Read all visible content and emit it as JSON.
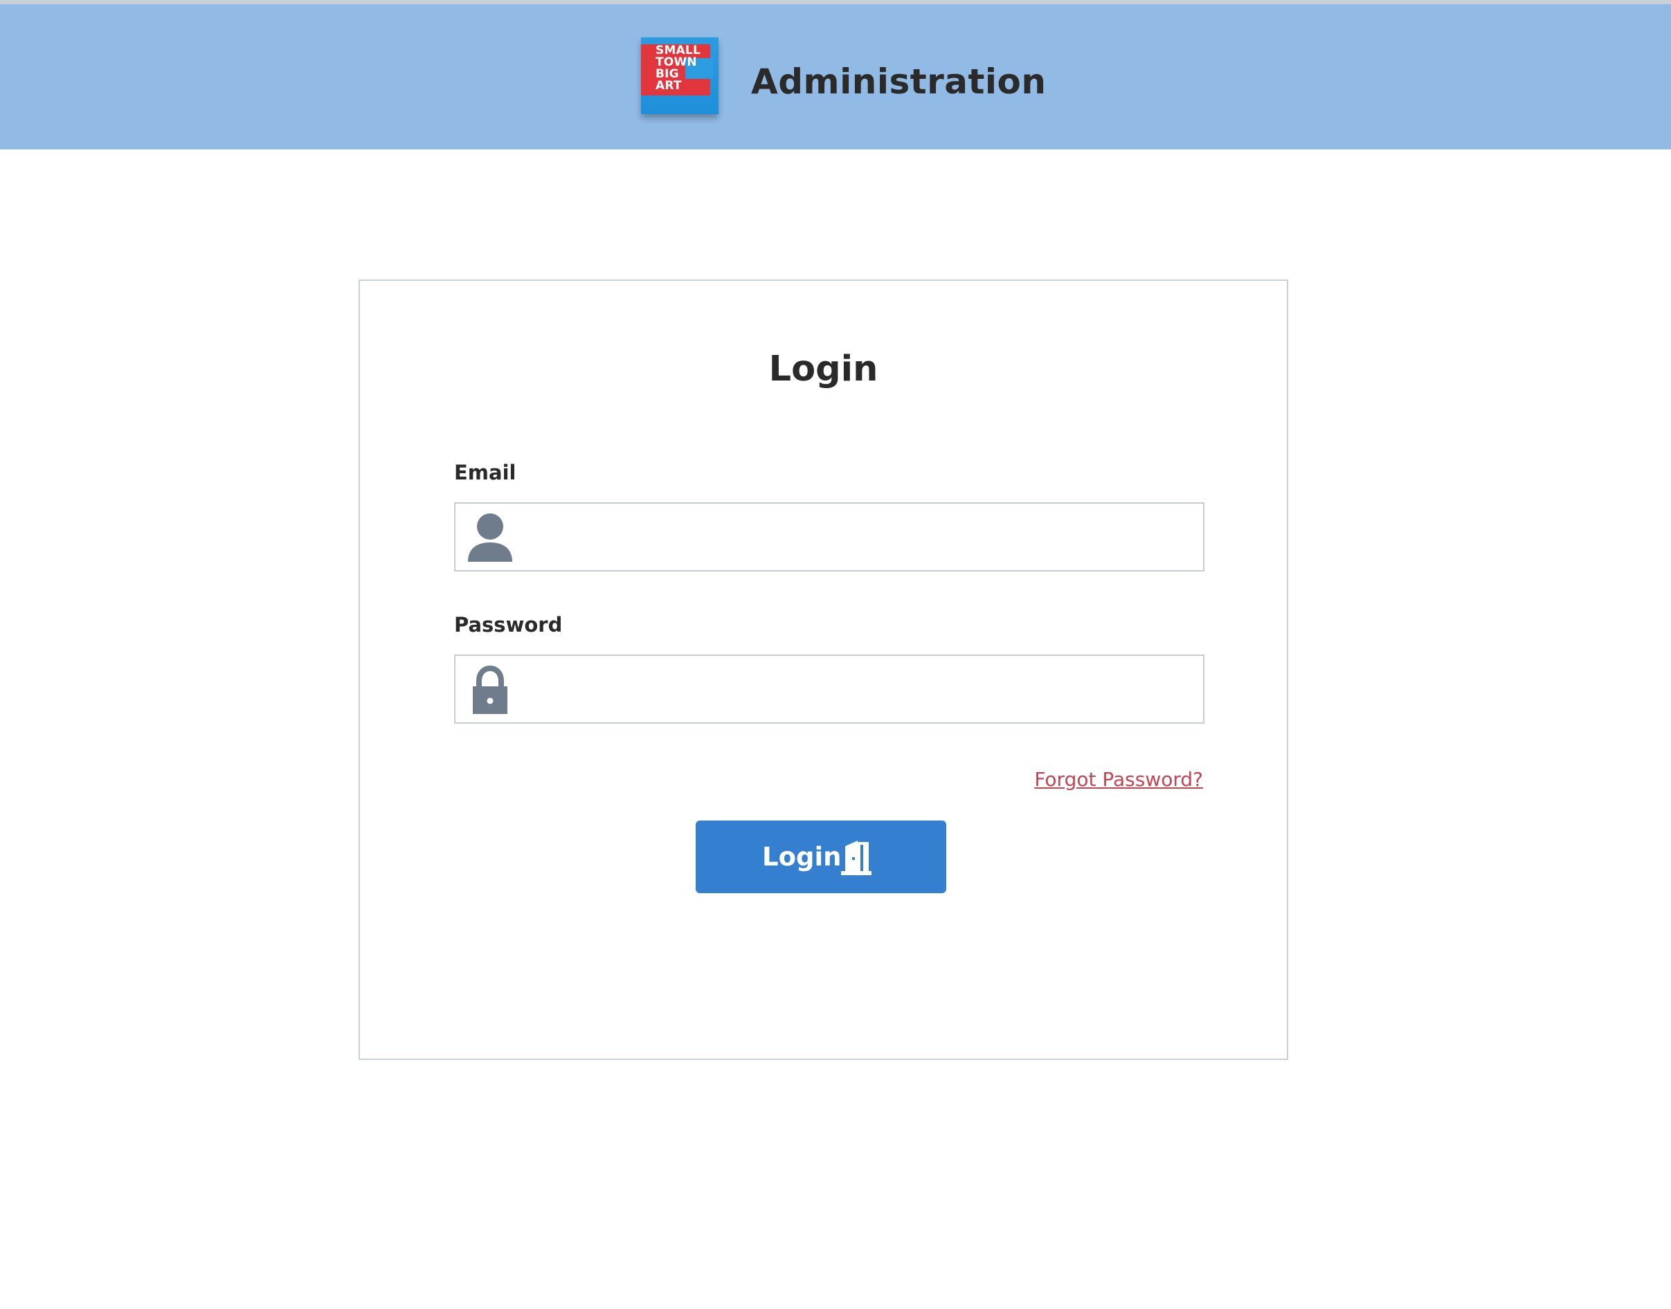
{
  "header": {
    "title": "Administration",
    "logo": {
      "lines": [
        "SMALL",
        "TOWN",
        "BIG",
        "ART"
      ],
      "colors": {
        "red": "#e2363f",
        "blue": "#2d9be0"
      }
    },
    "background": "#91bae4"
  },
  "login_form": {
    "title": "Login",
    "email": {
      "label": "Email",
      "value": "",
      "placeholder": "",
      "icon": "user-icon"
    },
    "password": {
      "label": "Password",
      "value": "",
      "placeholder": "",
      "icon": "lock-icon"
    },
    "forgot_password_label": "Forgot Password?",
    "submit": {
      "label": "Login",
      "icon": "door-icon"
    }
  },
  "colors": {
    "accent": "#347fd0",
    "link": "#c24652",
    "icon": "#6f7c8b",
    "border": "#c7d1dc"
  }
}
